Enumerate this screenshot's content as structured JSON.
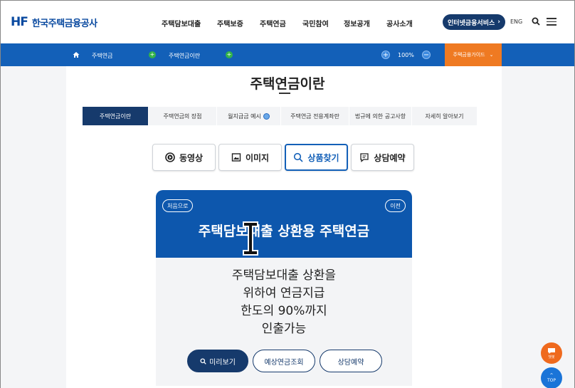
{
  "header": {
    "logo_mark": "HF",
    "logo_text": "한국주택금융공사",
    "nav": [
      "주택담보대출",
      "주택보증",
      "주택연금",
      "국민참여",
      "정보공개",
      "공사소개"
    ],
    "internet_button": "인터넷금융서비스",
    "lang": "ENG"
  },
  "bluebar": {
    "breadcrumb_1": "주택연금",
    "breadcrumb_2": "주택연금이란",
    "zoom": "100%",
    "guide": "주택금융가이드"
  },
  "page": {
    "title": "주택연금이란"
  },
  "tabs": [
    {
      "label": "주택연금이란",
      "active": true
    },
    {
      "label": "주택연금의 장점",
      "active": false
    },
    {
      "label": "월지급금 예시",
      "active": false
    },
    {
      "label": "주택연금 전용계좌란",
      "active": false
    },
    {
      "label": "법규에 의한 공고사항",
      "active": false
    },
    {
      "label": "자세히 알아보기",
      "active": false
    }
  ],
  "types": [
    {
      "label": "동영상",
      "icon": "play-circle-icon"
    },
    {
      "label": "이미지",
      "icon": "image-icon"
    },
    {
      "label": "상품찾기",
      "icon": "search-icon",
      "active": true
    },
    {
      "label": "상담예약",
      "icon": "chat-icon"
    }
  ],
  "card": {
    "first": "처음으로",
    "prev": "이전",
    "title": "주택담보대출 상환용 주택연금",
    "body": [
      "주택담보대출 상환을",
      "위하여 연금지급",
      "한도의 90%까지",
      "인출가능"
    ],
    "preview": "미리보기",
    "estimate": "예상연금조회",
    "consult": "상담예약"
  },
  "floating": {
    "chat": "챗봇",
    "top": "TOP"
  },
  "colors": {
    "primary_navy": "#163a6c",
    "bar_blue": "#1360b8",
    "accent_orange": "#ef7a22"
  }
}
